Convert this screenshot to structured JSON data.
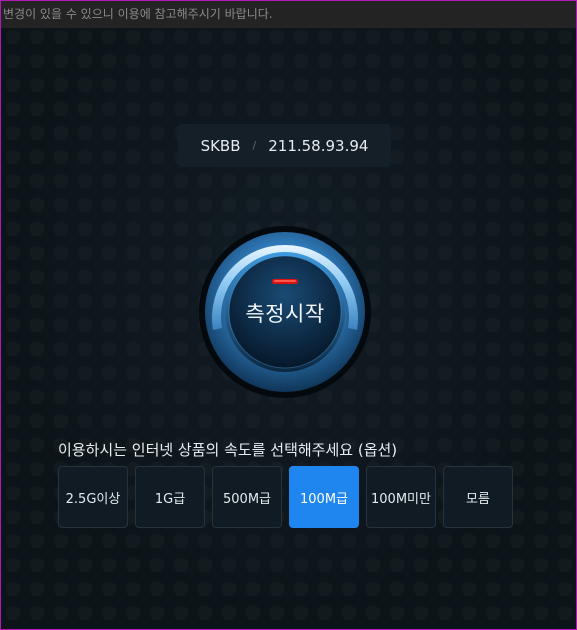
{
  "notice": {
    "text": "변경이 있을 수 있으니 이용에 참고해주시기 바랍니다."
  },
  "isp": {
    "name": "SKBB",
    "separator": "/",
    "ip": "211.58.93.94"
  },
  "start_button": {
    "label": "측정시작"
  },
  "speed_select": {
    "prompt": "이용하시는 인터넷 상품의 속도를 선택해주세요 (옵션)",
    "options": [
      {
        "label": "2.5G이상"
      },
      {
        "label": "1G급"
      },
      {
        "label": "500M급"
      },
      {
        "label": "100M급"
      },
      {
        "label": "100M미만"
      },
      {
        "label": "모름"
      }
    ],
    "selected": "100M급"
  },
  "colors": {
    "accent": "#1f86ef",
    "indicator": "#e01010",
    "ring_light": "#7fc4f2",
    "border": "#b01ab5"
  }
}
